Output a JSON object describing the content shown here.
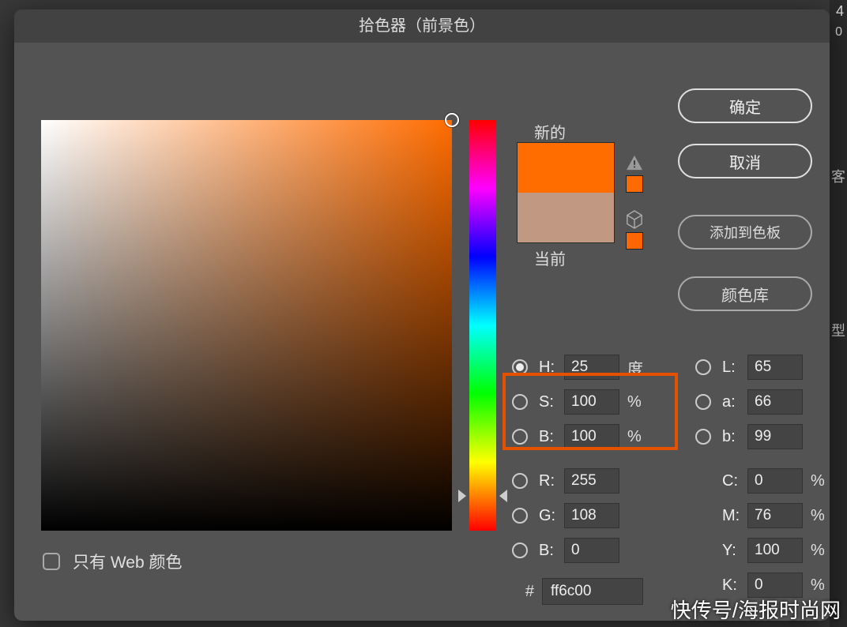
{
  "background": {
    "top_number": "4",
    "zero": "0",
    "char1": "客",
    "char2": "型"
  },
  "dialog": {
    "title": "拾色器（前景色）",
    "buttons": {
      "ok": "确定",
      "cancel": "取消",
      "add_to_swatches": "添加到色板",
      "color_libraries": "颜色库"
    },
    "swatch": {
      "new_label": "新的",
      "current_label": "当前",
      "new_color": "#ff6c00",
      "current_color": "#c19882"
    },
    "hsb": {
      "h": {
        "label": "H:",
        "value": "25",
        "unit": "度"
      },
      "s": {
        "label": "S:",
        "value": "100",
        "unit": "%"
      },
      "b": {
        "label": "B:",
        "value": "100",
        "unit": "%"
      }
    },
    "rgb": {
      "r": {
        "label": "R:",
        "value": "255"
      },
      "g": {
        "label": "G:",
        "value": "108"
      },
      "b": {
        "label": "B:",
        "value": "0"
      }
    },
    "lab": {
      "l": {
        "label": "L:",
        "value": "65"
      },
      "a": {
        "label": "a:",
        "value": "66"
      },
      "b": {
        "label": "b:",
        "value": "99"
      }
    },
    "cmyk": {
      "c": {
        "label": "C:",
        "value": "0",
        "unit": "%"
      },
      "m": {
        "label": "M:",
        "value": "76",
        "unit": "%"
      },
      "y": {
        "label": "Y:",
        "value": "100",
        "unit": "%"
      },
      "k": {
        "label": "K:",
        "value": "0",
        "unit": "%"
      }
    },
    "hex": {
      "label": "#",
      "value": "ff6c00"
    },
    "web_only": {
      "label": "只有 Web 颜色",
      "checked": false
    },
    "selected_mode": "H"
  },
  "watermark": "快传号/海报时尚网"
}
